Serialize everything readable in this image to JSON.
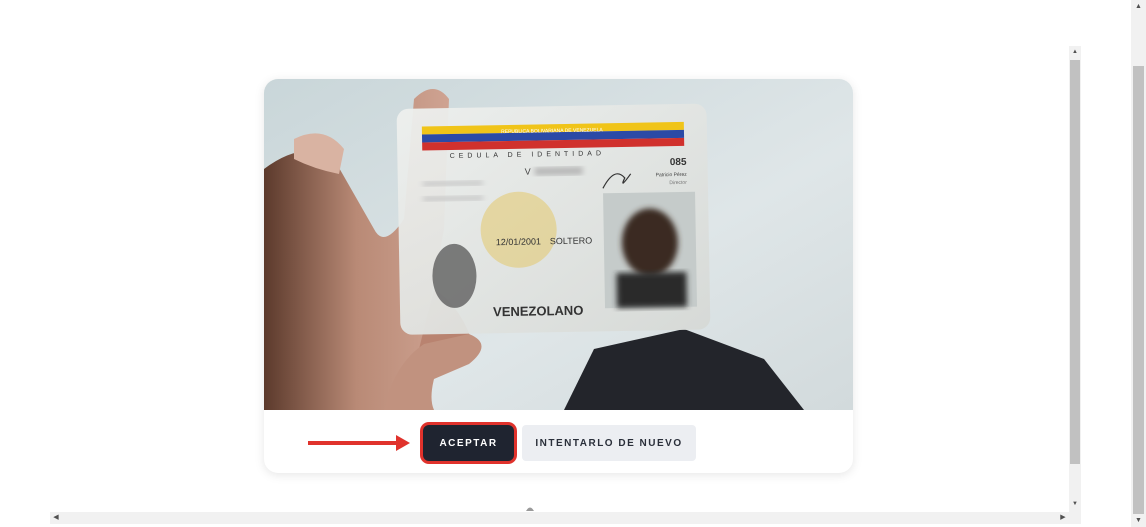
{
  "card": {
    "photo": {
      "card_header": "REPUBLICA BOLIVARIANA DE VENEZUELA",
      "card_title": "CEDULA DE IDENTIDAD",
      "id_prefix": "V",
      "number_code": "085",
      "signer_name": "Patricio Pérez",
      "signer_title": "Director",
      "dates": "12/01/2001",
      "civil_status": "SOLTERO",
      "nationality": "VENEZOLANO"
    },
    "actions": {
      "accept_label": "ACEPTAR",
      "retry_label": "INTENTARLO DE NUEVO"
    }
  },
  "colors": {
    "accept_bg": "#1f2430",
    "accept_outline": "#e0322c",
    "retry_bg": "#eceef2",
    "annotation_arrow": "#e0322c"
  },
  "icons": {
    "scroll_up": "triangle-up",
    "scroll_down": "triangle-down",
    "scroll_left": "triangle-left",
    "scroll_right": "triangle-right"
  }
}
